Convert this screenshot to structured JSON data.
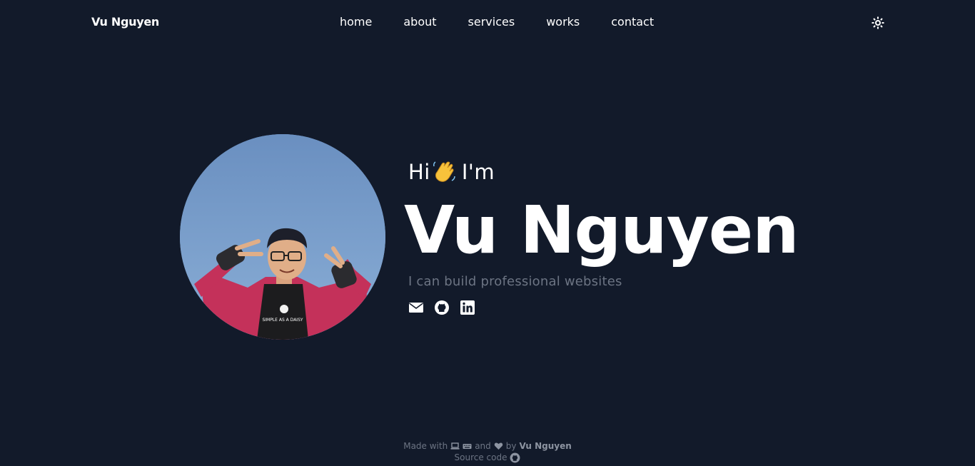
{
  "header": {
    "brand": "Vu Nguyen",
    "nav": [
      {
        "label": "home"
      },
      {
        "label": "about"
      },
      {
        "label": "services"
      },
      {
        "label": "works"
      },
      {
        "label": "contact"
      }
    ],
    "theme_toggle_icon": "sun-icon"
  },
  "hero": {
    "greeting_before": "Hi",
    "greeting_emoji": "waving-hand",
    "greeting_after": "I'm",
    "name": "Vu Nguyen",
    "tagline": "I can build professional websites",
    "socials": [
      {
        "icon": "email-icon"
      },
      {
        "icon": "github-icon"
      },
      {
        "icon": "linkedin-icon"
      }
    ]
  },
  "footer": {
    "made_with": "Made with",
    "and": "and",
    "by": "by",
    "author": "Vu Nguyen",
    "source_code": "Source code"
  },
  "colors": {
    "background": "#121a2a",
    "text": "#ffffff",
    "muted": "#6c7483"
  }
}
